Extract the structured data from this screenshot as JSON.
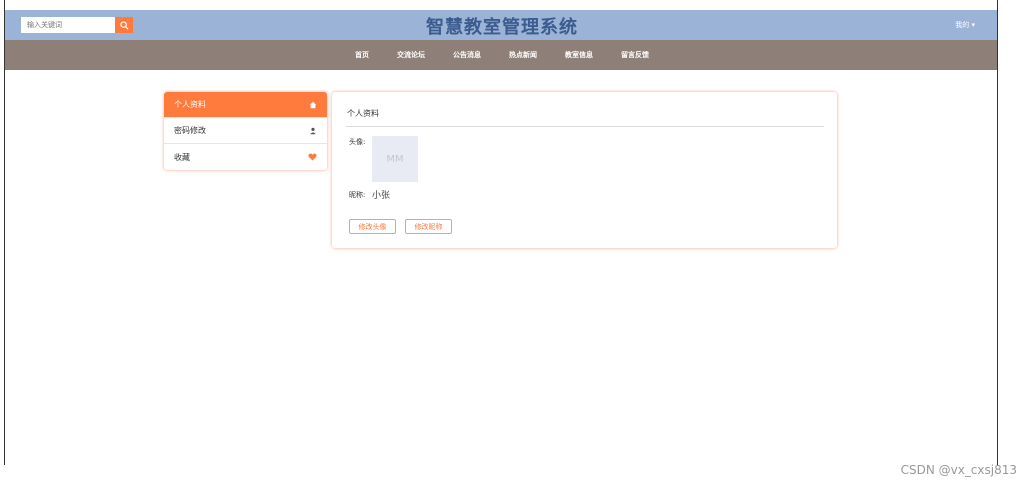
{
  "header": {
    "search_placeholder": "输入关键词",
    "title": "智慧教室管理系统",
    "user_menu": "我的 ▾"
  },
  "nav": {
    "items": [
      {
        "label": "首页"
      },
      {
        "label": "交流论坛"
      },
      {
        "label": "公告消息"
      },
      {
        "label": "热点新闻"
      },
      {
        "label": "教室信息"
      },
      {
        "label": "留言反馈"
      }
    ]
  },
  "sidebar": {
    "items": [
      {
        "label": "个人资料",
        "icon": "home-icon"
      },
      {
        "label": "密码修改",
        "icon": "user-icon"
      },
      {
        "label": "收藏",
        "icon": "heart-icon"
      }
    ]
  },
  "profile": {
    "title": "个人资料",
    "avatar_label": "头像:",
    "avatar_placeholder": "MM",
    "nickname_label": "昵称:",
    "nickname_value": "小张",
    "change_avatar_button": "修改头像",
    "change_nickname_button": "修改昵称"
  },
  "watermark": "CSDN @vx_cxsj813",
  "colors": {
    "accent": "#ff7a3d",
    "topbar": "#9bb3d6",
    "nav": "#8e7f79"
  }
}
